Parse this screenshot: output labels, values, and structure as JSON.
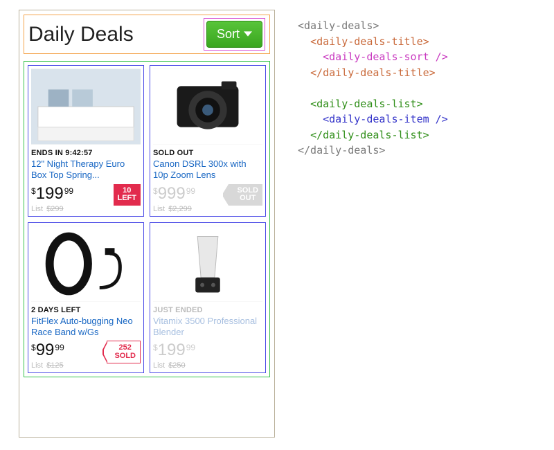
{
  "header": {
    "title": "Daily Deals",
    "sort_label": "Sort"
  },
  "items": [
    {
      "status": "ENDS IN 9:42:57",
      "status_dim": false,
      "name": "12\" Night Therapy Euro Box Top Spring...",
      "name_dim": false,
      "currency": "$",
      "price_main": "199",
      "price_cents": "99",
      "price_dim": false,
      "list_label": "List",
      "list_price": "$299",
      "badge_l1": "10",
      "badge_l2": "LEFT",
      "badge_kind": "red"
    },
    {
      "status": "SOLD OUT",
      "status_dim": false,
      "name": "Canon DSRL 300x with 10p Zoom Lens",
      "name_dim": false,
      "currency": "$",
      "price_main": "999",
      "price_cents": "99",
      "price_dim": true,
      "list_label": "List",
      "list_price": "$2,299",
      "badge_l1": "SOLD",
      "badge_l2": "OUT",
      "badge_kind": "sold"
    },
    {
      "status": "2 DAYS LEFT",
      "status_dim": false,
      "name": "FitFlex Auto-bugging Neo Race Band w/Gs",
      "name_dim": false,
      "currency": "$",
      "price_main": "99",
      "price_cents": "99",
      "price_dim": false,
      "list_label": "List",
      "list_price": "$125",
      "badge_l1": "252",
      "badge_l2": "SOLD",
      "badge_kind": "outline"
    },
    {
      "status": "JUST ENDED",
      "status_dim": true,
      "name": "Vitamix 3500 Professional Blender",
      "name_dim": true,
      "currency": "$",
      "price_main": "199",
      "price_cents": "99",
      "price_dim": true,
      "list_label": "List",
      "list_price": "$250",
      "badge_l1": "",
      "badge_l2": "",
      "badge_kind": "none"
    }
  ],
  "code": {
    "root_open": "<daily-deals>",
    "title_open": "<daily-deals-title>",
    "sort": "<daily-deals-sort />",
    "title_close": "</daily-deals-title>",
    "list_open": "<daily-deals-list>",
    "item": "<daily-deals-item />",
    "list_close": "</daily-deals-list>",
    "root_close": "</daily-deals>"
  }
}
